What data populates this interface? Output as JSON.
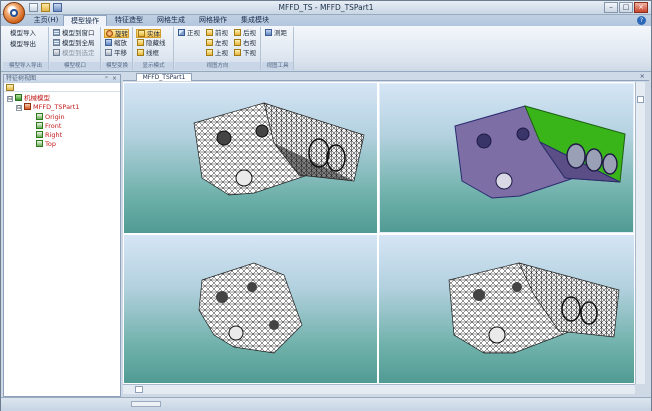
{
  "window": {
    "title": "MFFD_TS - MFFD_TSPart1"
  },
  "ribbon": {
    "tabs": [
      {
        "label": "主页(H)"
      },
      {
        "label": "模型操作"
      },
      {
        "label": "特征造型"
      },
      {
        "label": "网格生成"
      },
      {
        "label": "网格操作"
      },
      {
        "label": "集成模块"
      }
    ],
    "active_tab": "模型操作",
    "groups": [
      {
        "caption": "模型导入导出",
        "buttons": [
          "模型导入",
          "模型导出"
        ]
      },
      {
        "caption": "模型视口",
        "buttons": [
          "模型到窗口",
          "模型到全局",
          "模型到选定"
        ]
      },
      {
        "caption": "模型变换",
        "buttons": [
          "旋转",
          "缩放",
          "平移"
        ]
      },
      {
        "caption": "显示模式",
        "buttons": [
          "实体",
          "隐藏线",
          "线框"
        ]
      },
      {
        "caption": "视图方向",
        "buttons": [
          "正视",
          "前视",
          "后视",
          "左视",
          "右视",
          "上视",
          "下视"
        ]
      },
      {
        "caption": "视图工具",
        "buttons": [
          "测距"
        ]
      }
    ]
  },
  "left_panel": {
    "title": "特征树视图",
    "pin": "ᵖ",
    "close": "×",
    "tree": [
      {
        "label": "机械模型",
        "level": 0,
        "expander": "⊟"
      },
      {
        "label": "MFFD_TSPart1",
        "level": 1,
        "expander": "⊟"
      },
      {
        "label": "Origin",
        "level": 2
      },
      {
        "label": "Front",
        "level": 2
      },
      {
        "label": "Right",
        "level": 2
      },
      {
        "label": "Top",
        "level": 2
      }
    ]
  },
  "document": {
    "tab": "MFFD_TSPart1",
    "close": "×",
    "views": [
      {
        "mode": "mesh"
      },
      {
        "mode": "shaded"
      },
      {
        "mode": "mesh-side"
      },
      {
        "mode": "mesh-top"
      }
    ]
  },
  "help_icon": "?",
  "colors": {
    "ribbon_selected": "#f6c24a",
    "tree_label": "#c21818",
    "viewport_top": "#d5e5f6",
    "viewport_bottom": "#509b94",
    "shaded_body": "#7d6fa6",
    "shaded_top": "#39b51a"
  }
}
